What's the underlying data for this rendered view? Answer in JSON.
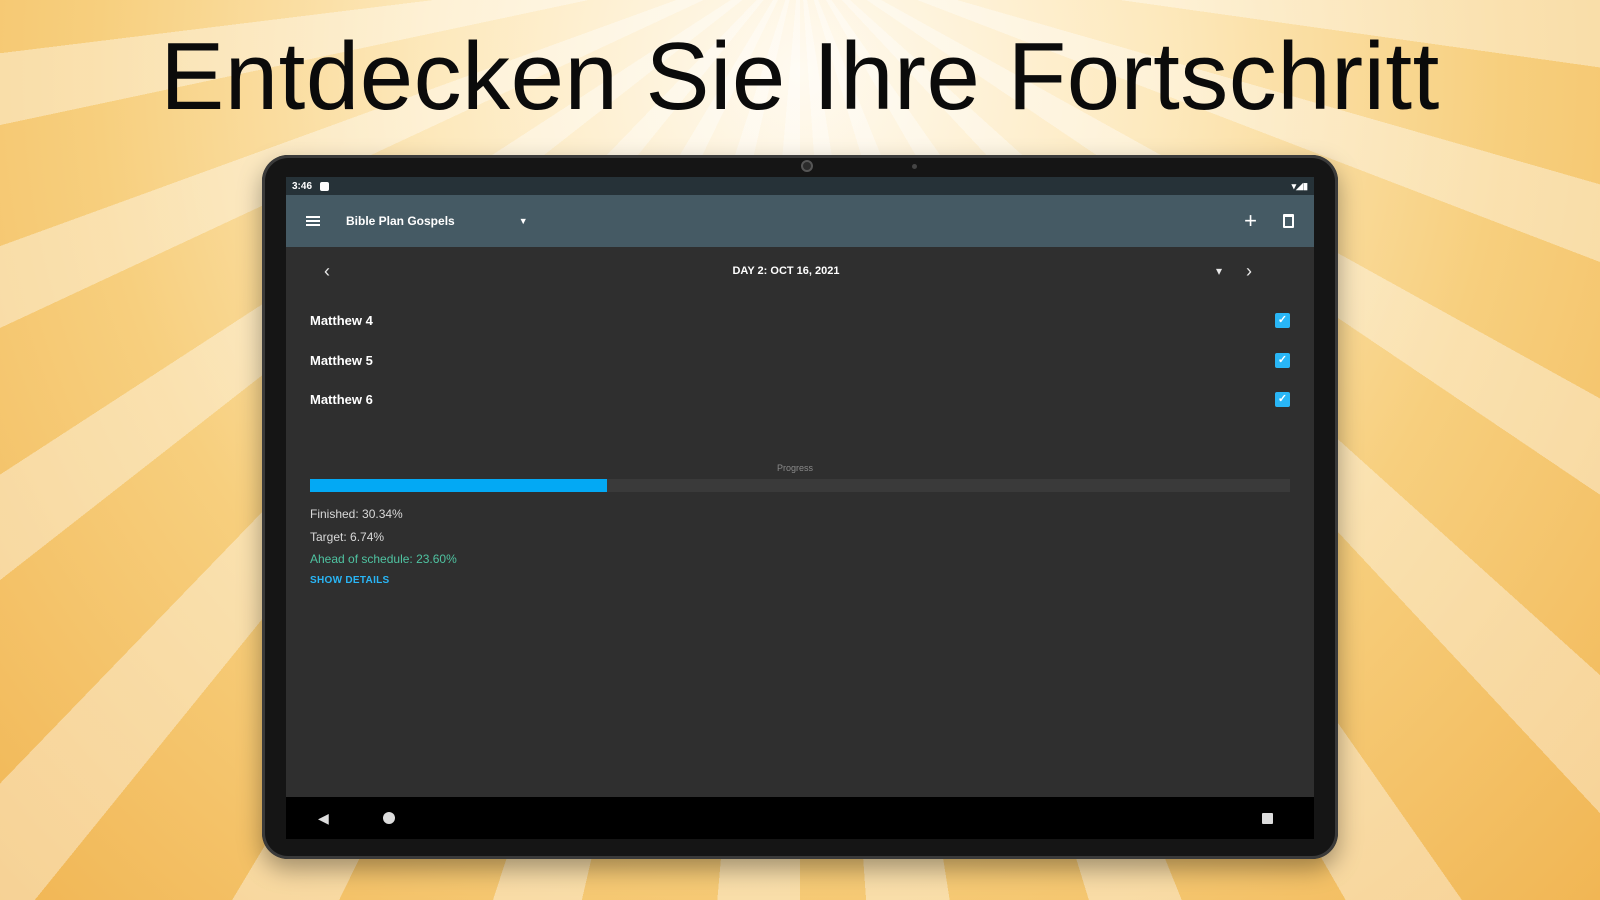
{
  "headline": "Entdecken Sie Ihre Fortschritt",
  "status_bar": {
    "time": "3:46",
    "icons": "▾◢▮"
  },
  "app_bar": {
    "title": "Bible Plan Gospels",
    "caret": "▼",
    "add": "+"
  },
  "day_nav": {
    "label": "DAY 2: OCT 16, 2021",
    "prev": "‹",
    "next": "›",
    "dropdown": "▾"
  },
  "readings": [
    {
      "label": "Matthew 4",
      "checked": true
    },
    {
      "label": "Matthew 5",
      "checked": true
    },
    {
      "label": "Matthew 6",
      "checked": true
    }
  ],
  "progress": {
    "caption": "Progress",
    "value_percent": 30.34,
    "finished": "Finished: 30.34%",
    "target": "Target: 6.74%",
    "ahead": "Ahead of schedule: 23.60%",
    "show_details": "SHOW DETAILS"
  },
  "colors": {
    "app_bar": "#455a64",
    "accent": "#03a9f4",
    "ahead": "#4fc3a1",
    "background": "#2f2f2f"
  },
  "icons": {
    "menu": "menu-icon",
    "dropdown": "chevron-down-icon",
    "add": "plus-icon",
    "delete": "trash-icon",
    "check": "checkbox-checked-icon",
    "back": "back-triangle-icon",
    "home": "home-circle-icon",
    "recents": "recents-square-icon"
  },
  "nav_bar": {
    "back": "◀"
  }
}
